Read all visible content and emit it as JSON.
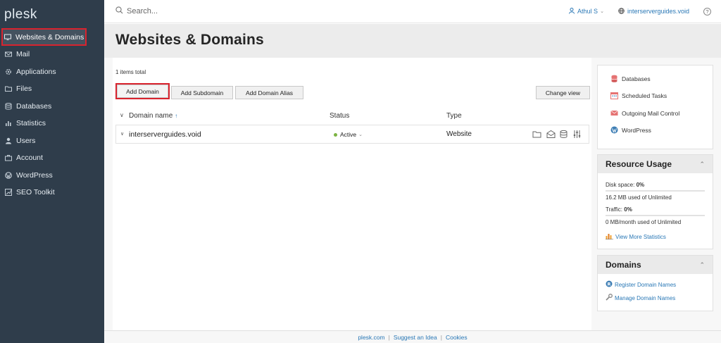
{
  "app": {
    "logo": "plesk"
  },
  "sidebar": {
    "items": [
      {
        "label": "Websites & Domains",
        "icon": "monitor-icon"
      },
      {
        "label": "Mail",
        "icon": "mail-icon"
      },
      {
        "label": "Applications",
        "icon": "gear-icon"
      },
      {
        "label": "Files",
        "icon": "folder-icon"
      },
      {
        "label": "Databases",
        "icon": "database-icon"
      },
      {
        "label": "Statistics",
        "icon": "statistics-icon"
      },
      {
        "label": "Users",
        "icon": "user-icon"
      },
      {
        "label": "Account",
        "icon": "account-icon"
      },
      {
        "label": "WordPress",
        "icon": "wordpress-icon"
      },
      {
        "label": "SEO Toolkit",
        "icon": "seo-icon"
      }
    ]
  },
  "topbar": {
    "search_placeholder": "Search...",
    "user": "Athul S",
    "subscription": "interserverguides.void",
    "help": "?"
  },
  "page": {
    "title": "Websites & Domains",
    "items_total": "1 items total"
  },
  "toolbar": {
    "add_domain": "Add Domain",
    "add_subdomain": "Add Subdomain",
    "add_domain_alias": "Add Domain Alias",
    "change_view": "Change view"
  },
  "table": {
    "columns": {
      "name": "Domain name",
      "status": "Status",
      "type": "Type"
    },
    "rows": [
      {
        "domain": "interserverguides.void",
        "status": "Active",
        "type": "Website"
      }
    ]
  },
  "quick_links": [
    {
      "label": "Databases",
      "icon": "database-icon"
    },
    {
      "label": "Scheduled Tasks",
      "icon": "calendar-icon"
    },
    {
      "label": "Outgoing Mail Control",
      "icon": "mail-icon"
    },
    {
      "label": "WordPress",
      "icon": "wordpress-icon"
    }
  ],
  "resource_usage": {
    "title": "Resource Usage",
    "disk_label": "Disk space:",
    "disk_value": "0%",
    "disk_detail": "16.2 MB used of Unlimited",
    "traffic_label": "Traffic:",
    "traffic_value": "0%",
    "traffic_detail": "0 MB/month used of Unlimited",
    "more_link": "View More Statistics"
  },
  "domains_panel": {
    "title": "Domains",
    "register": "Register Domain Names",
    "manage": "Manage Domain Names"
  },
  "footer": {
    "links": [
      "plesk.com",
      "Suggest an Idea",
      "Cookies"
    ]
  },
  "colors": {
    "sidebar_bg": "#2f3d4b",
    "link": "#2a78b6",
    "highlight": "#d9232e",
    "active_dot": "#7cb342"
  }
}
